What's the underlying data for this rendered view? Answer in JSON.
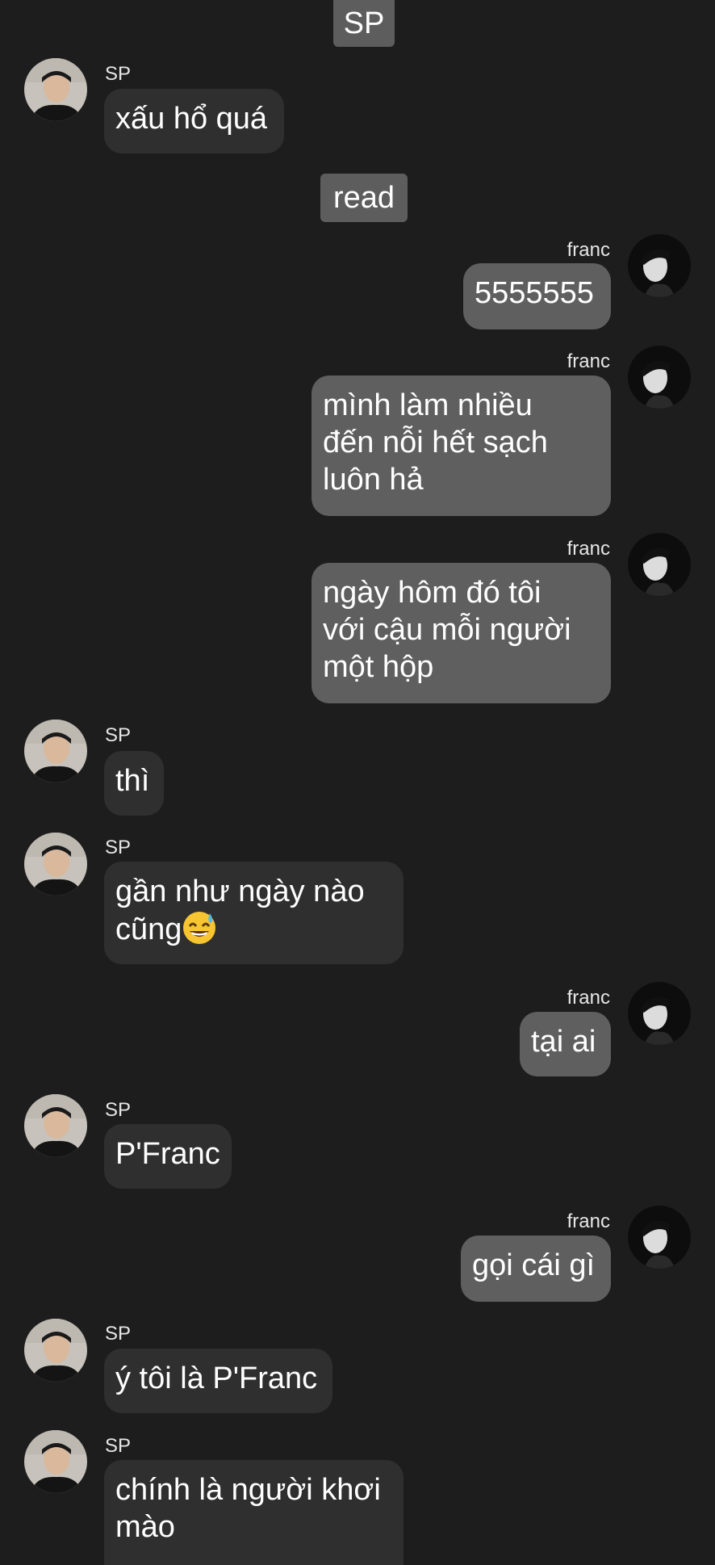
{
  "labels": {
    "top": "SP",
    "read": "read"
  },
  "contacts": {
    "sp": "SP",
    "franc": "franc"
  },
  "messages": [
    {
      "from": "SP",
      "text": "xấu hổ quá"
    },
    {
      "from": "franc",
      "text": "5555555"
    },
    {
      "from": "franc",
      "lines": [
        "mình làm nhiều",
        "đến nỗi hết sạch",
        "luôn hả"
      ]
    },
    {
      "from": "franc",
      "lines": [
        "ngày hôm đó tôi",
        "với cậu mỗi người",
        "một hộp"
      ]
    },
    {
      "from": "SP",
      "text": "thì"
    },
    {
      "from": "SP",
      "lines": [
        "gần như ngày nào",
        "cũng"
      ],
      "emoji": "grinning-sweat-emoji"
    },
    {
      "from": "franc",
      "text": "tại ai"
    },
    {
      "from": "SP",
      "text": "P'Franc"
    },
    {
      "from": "franc",
      "text": "gọi cái gì"
    },
    {
      "from": "SP",
      "text": "ý tôi là P'Franc"
    },
    {
      "from": "SP",
      "lines": [
        "chính là người khơi",
        "mào"
      ]
    }
  ],
  "colors": {
    "background": "#1d1d1d",
    "incoming_bubble": "#2f2f2f",
    "outgoing_bubble": "#5f5f5f",
    "chip": "#5d5d5d"
  }
}
